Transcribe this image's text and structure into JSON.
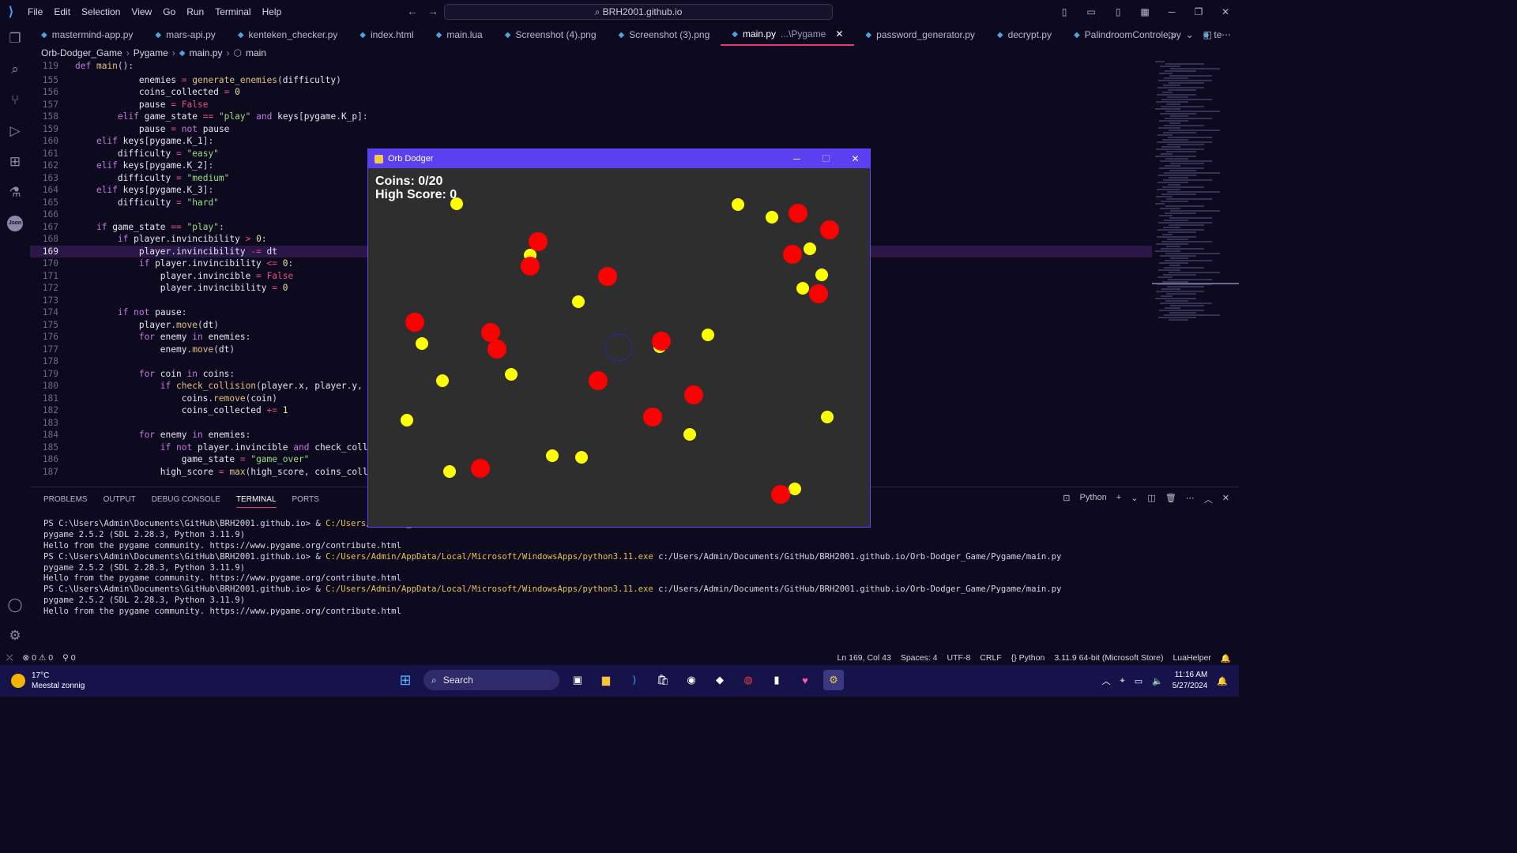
{
  "titlebar": {
    "menu": [
      "File",
      "Edit",
      "Selection",
      "View",
      "Go",
      "Run",
      "Terminal",
      "Help"
    ],
    "command_center": "BRH2001.github.io"
  },
  "tabs": [
    {
      "label": "mastermind-app.py",
      "active": false
    },
    {
      "label": "mars-api.py",
      "active": false
    },
    {
      "label": "kenteken_checker.py",
      "active": false
    },
    {
      "label": "index.html",
      "active": false
    },
    {
      "label": "main.lua",
      "active": false
    },
    {
      "label": "Screenshot (4).png",
      "active": false
    },
    {
      "label": "Screenshot (3).png",
      "active": false
    },
    {
      "label": "main.py",
      "suffix": "...\\Pygame",
      "active": true
    },
    {
      "label": "password_generator.py",
      "active": false
    },
    {
      "label": "decrypt.py",
      "active": false
    },
    {
      "label": "PalindroomControle.py",
      "active": false
    },
    {
      "label": "te",
      "active": false
    }
  ],
  "breadcrumb": [
    "Orb-Dodger_Game",
    "Pygame",
    "main.py",
    "main"
  ],
  "editor": {
    "sticky": {
      "ln": "119",
      "code": "def main():"
    },
    "lines": [
      {
        "ln": "155",
        "code": "            enemies = generate_enemies(difficulty)"
      },
      {
        "ln": "156",
        "code": "            coins_collected = 0"
      },
      {
        "ln": "157",
        "code": "            pause = False"
      },
      {
        "ln": "158",
        "code": "        elif game_state == \"play\" and keys[pygame.K_p]:"
      },
      {
        "ln": "159",
        "code": "            pause = not pause"
      },
      {
        "ln": "160",
        "code": "    elif keys[pygame.K_1]:"
      },
      {
        "ln": "161",
        "code": "        difficulty = \"easy\""
      },
      {
        "ln": "162",
        "code": "    elif keys[pygame.K_2]:"
      },
      {
        "ln": "163",
        "code": "        difficulty = \"medium\""
      },
      {
        "ln": "164",
        "code": "    elif keys[pygame.K_3]:"
      },
      {
        "ln": "165",
        "code": "        difficulty = \"hard\""
      },
      {
        "ln": "166",
        "code": ""
      },
      {
        "ln": "167",
        "code": "    if game_state == \"play\":"
      },
      {
        "ln": "168",
        "code": "        if player.invincibility > 0:"
      },
      {
        "ln": "169",
        "code": "            player.invincibility -= dt"
      },
      {
        "ln": "170",
        "code": "            if player.invincibility <= 0:"
      },
      {
        "ln": "171",
        "code": "                player.invincible = False"
      },
      {
        "ln": "172",
        "code": "                player.invincibility = 0"
      },
      {
        "ln": "173",
        "code": ""
      },
      {
        "ln": "174",
        "code": "        if not pause:"
      },
      {
        "ln": "175",
        "code": "            player.move(dt)"
      },
      {
        "ln": "176",
        "code": "            for enemy in enemies:"
      },
      {
        "ln": "177",
        "code": "                enemy.move(dt)"
      },
      {
        "ln": "178",
        "code": ""
      },
      {
        "ln": "179",
        "code": "            for coin in coins:"
      },
      {
        "ln": "180",
        "code": "                if check_collision(player.x, player.y,"
      },
      {
        "ln": "181",
        "code": "                    coins.remove(coin)"
      },
      {
        "ln": "182",
        "code": "                    coins_collected += 1"
      },
      {
        "ln": "183",
        "code": ""
      },
      {
        "ln": "184",
        "code": "            for enemy in enemies:"
      },
      {
        "ln": "185",
        "code": "                if not player.invincible and check_coll"
      },
      {
        "ln": "186",
        "code": "                    game_state = \"game_over\""
      },
      {
        "ln": "187",
        "code": "                high_score = max(high_score, coins_coll"
      }
    ],
    "current_line": "169"
  },
  "panel": {
    "tabs": [
      "PROBLEMS",
      "OUTPUT",
      "DEBUG CONSOLE",
      "TERMINAL",
      "PORTS"
    ],
    "active_tab": "TERMINAL",
    "shell": "Python",
    "terminal": [
      {
        "prompt": "PS C:\\Users\\Admin\\Documents\\GitHub\\BRH2001.github.io> & ",
        "exe": "C:/Users/Admin/A",
        "args": "_Game/Pygame/main.py"
      },
      {
        "text": "pygame 2.5.2 (SDL 2.28.3, Python 3.11.9)"
      },
      {
        "text": "Hello from the pygame community. https://www.pygame.org/contribute.html"
      },
      {
        "prompt": "PS C:\\Users\\Admin\\Documents\\GitHub\\BRH2001.github.io> & ",
        "exe": "C:/Users/Admin/AppData/Local/Microsoft/WindowsApps/python3.11.exe",
        "args": " c:/Users/Admin/Documents/GitHub/BRH2001.github.io/Orb-Dodger_Game/Pygame/main.py"
      },
      {
        "text": "pygame 2.5.2 (SDL 2.28.3, Python 3.11.9)"
      },
      {
        "text": "Hello from the pygame community. https://www.pygame.org/contribute.html"
      },
      {
        "prompt": "PS C:\\Users\\Admin\\Documents\\GitHub\\BRH2001.github.io> & ",
        "exe": "C:/Users/Admin/AppData/Local/Microsoft/WindowsApps/python3.11.exe",
        "args": " c:/Users/Admin/Documents/GitHub/BRH2001.github.io/Orb-Dodger_Game/Pygame/main.py"
      },
      {
        "text": "pygame 2.5.2 (SDL 2.28.3, Python 3.11.9)"
      },
      {
        "text": "Hello from the pygame community. https://www.pygame.org/contribute.html"
      }
    ]
  },
  "status": {
    "errors": "0",
    "warnings": "0",
    "ports": "0",
    "ln_col": "Ln 169, Col 43",
    "spaces": "Spaces: 4",
    "encoding": "UTF-8",
    "eol": "CRLF",
    "language": "Python",
    "interpreter": "3.11.9 64-bit (Microsoft Store)",
    "extension": "LuaHelper"
  },
  "game": {
    "title": "Orb Dodger",
    "coins_text": "Coins: 0/20",
    "highscore_text": "High Score: 0",
    "coin_color": "#ffff00",
    "enemy_color": "#ff0000",
    "background": "#2e2e2e"
  },
  "taskbar": {
    "temperature": "17°C",
    "weather": "Meestal zonnig",
    "search_label": "Search",
    "time": "11:16 AM",
    "date": "5/27/2024"
  }
}
